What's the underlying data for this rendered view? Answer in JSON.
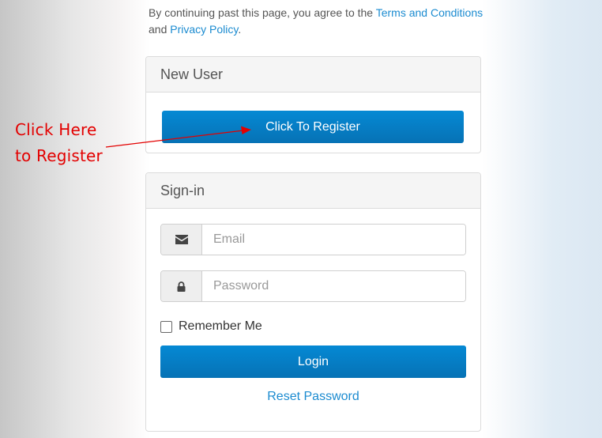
{
  "agreement": {
    "prefix": "By continuing past this page, you agree to the ",
    "terms_link": "Terms and Conditions",
    "middle": "and ",
    "privacy_link": "Privacy Policy",
    "suffix": "."
  },
  "new_user_panel": {
    "title": "New User",
    "register_button": "Click To Register"
  },
  "signin_panel": {
    "title": "Sign-in",
    "email": {
      "icon": "envelope-icon",
      "placeholder": "Email",
      "value": ""
    },
    "password": {
      "icon": "lock-icon",
      "placeholder": "Password",
      "value": ""
    },
    "remember_me": {
      "label": "Remember Me",
      "checked": false
    },
    "login_button": "Login",
    "reset_link": "Reset Password"
  },
  "annotation": {
    "line1": "Click Here",
    "line2": "to Register",
    "color": "#e30000"
  },
  "colors": {
    "primary_button": "#0672b5",
    "link": "#1b8bd0"
  }
}
